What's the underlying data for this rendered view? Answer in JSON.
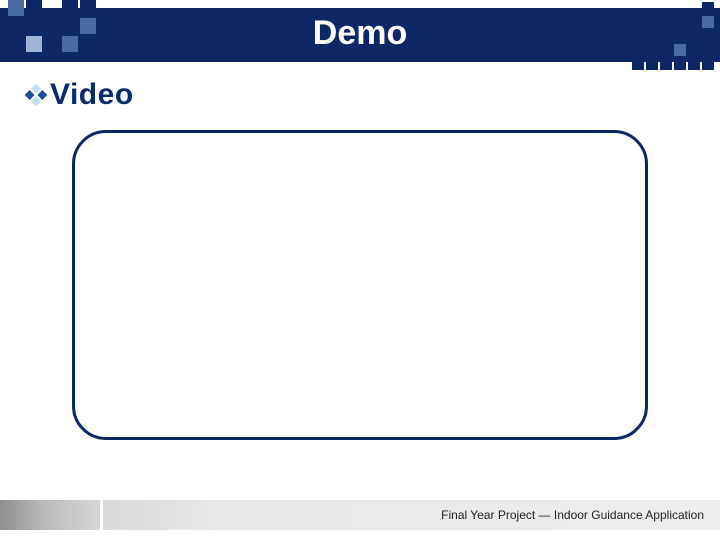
{
  "header": {
    "title": "Demo"
  },
  "subheading": {
    "bullet_icon": "diamond-bullet-icon",
    "label": "Video"
  },
  "content": {
    "video_placeholder": {
      "present": true
    }
  },
  "footer": {
    "text": "Final Year Project — Indoor Guidance Application"
  },
  "colors": {
    "navy": "#0e2767",
    "accent_mid": "#4a6aa5",
    "accent_light": "#9fb4d8",
    "bullet_light": "#bfe1f3",
    "bullet_dark": "#1f4e8c"
  }
}
